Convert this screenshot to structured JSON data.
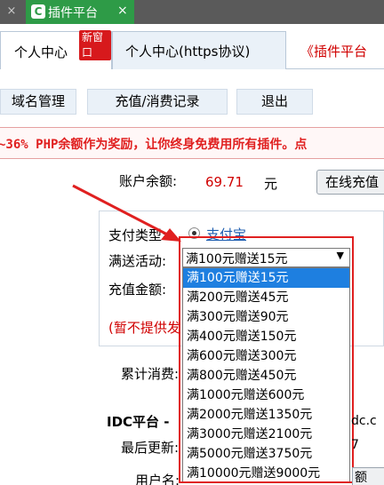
{
  "topbar": {
    "close_glyph": "×",
    "tab_icon_glyph": "C",
    "tab_label": "插件平台",
    "tab_close_glyph": "×"
  },
  "tabs": [
    {
      "label": "个人中心",
      "badge": "新窗口"
    },
    {
      "label": "个人中心(https协议)"
    },
    {
      "label": "《插件平台"
    }
  ],
  "nav": [
    "域名管理",
    "充值/消费记录",
    "退出"
  ],
  "marquee_text": "~36% PHP余额作为奖励，让你终身免费用所有插件。点",
  "balance": {
    "label": "账户余额:",
    "value": "69.71",
    "unit": "元",
    "button": "在线充值"
  },
  "recharge": {
    "pay_label": "支付类型:",
    "pay_option": "支付宝",
    "promo_label": "满送活动:",
    "amount_label": "充值金额:",
    "note": "(暂不提供发"
  },
  "select": {
    "value": "满100元赠送15元",
    "arrow_glyph": "▼",
    "options": [
      "满100元赠送15元",
      "满200元赠送45元",
      "满300元赠送90元",
      "满400元赠送150元",
      "满600元赠送300元",
      "满800元赠送450元",
      "满1000元赠送600元",
      "满2000元赠送1350元",
      "满3000元赠送2100元",
      "满5000元赠送3750元",
      "满10000元赠送9000元"
    ],
    "selected_index": 0
  },
  "lower": {
    "total_consume": "累计消费:",
    "idc": "IDC平台 -",
    "idc_right": "dc.c",
    "last_update": "最后更新:",
    "last_right": "7",
    "username": "用户名:",
    "small_button": "额"
  },
  "colors": {
    "accent": "#2e9b47",
    "highlight": "#1e7fe0",
    "alert": "#e02020"
  }
}
